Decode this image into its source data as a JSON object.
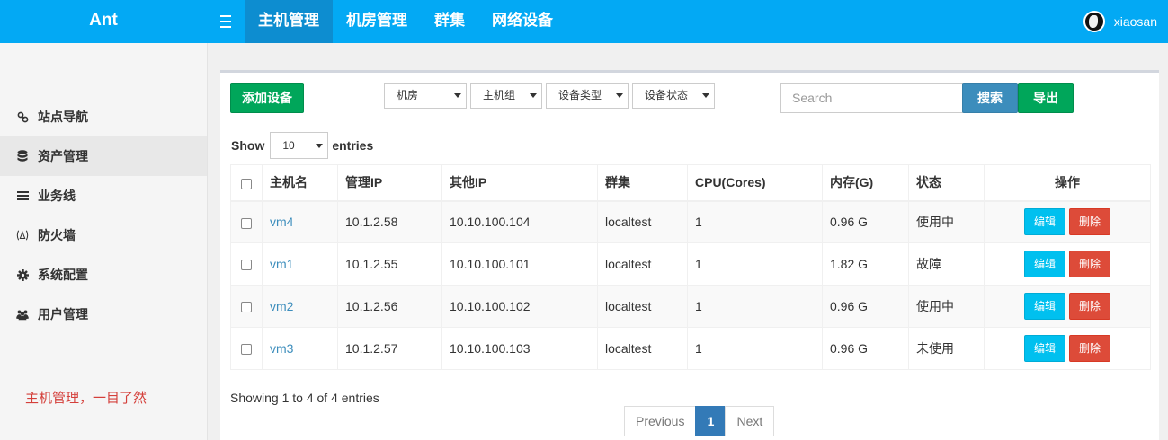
{
  "app": {
    "brand": "Ant"
  },
  "nav": {
    "items": [
      {
        "label": "主机管理",
        "active": true
      },
      {
        "label": "机房管理",
        "active": false
      },
      {
        "label": "群集",
        "active": false
      },
      {
        "label": "网络设备",
        "active": false
      }
    ],
    "username": "xiaosan"
  },
  "sidebar": {
    "items": [
      {
        "label": "站点导航",
        "icon": "link-icon"
      },
      {
        "label": "资产管理",
        "icon": "database-icon",
        "active": true
      },
      {
        "label": "业务线",
        "icon": "list-icon"
      },
      {
        "label": "防火墙",
        "icon": "fire-icon"
      },
      {
        "label": "系统配置",
        "icon": "gear-icon"
      },
      {
        "label": "用户管理",
        "icon": "users-icon"
      }
    ],
    "note": "主机管理，一目了然"
  },
  "toolbar": {
    "add_label": "添加设备",
    "filters": [
      "机房",
      "主机组",
      "设备类型",
      "设备状态"
    ],
    "search_placeholder": "Search",
    "search_label": "搜索",
    "export_label": "导出"
  },
  "length": {
    "show": "Show",
    "value": "10",
    "entries": "entries"
  },
  "table": {
    "headers": [
      "主机名",
      "管理IP",
      "其他IP",
      "群集",
      "CPU(Cores)",
      "内存(G)",
      "状态",
      "操作"
    ],
    "rows": [
      {
        "name": "vm4",
        "mgmt_ip": "10.1.2.58",
        "other_ip": "10.10.100.104",
        "cluster": "localtest",
        "cpu": "1",
        "mem": "0.96 G",
        "status": "使用中"
      },
      {
        "name": "vm1",
        "mgmt_ip": "10.1.2.55",
        "other_ip": "10.10.100.101",
        "cluster": "localtest",
        "cpu": "1",
        "mem": "1.82 G",
        "status": "故障"
      },
      {
        "name": "vm2",
        "mgmt_ip": "10.1.2.56",
        "other_ip": "10.10.100.102",
        "cluster": "localtest",
        "cpu": "1",
        "mem": "0.96 G",
        "status": "使用中"
      },
      {
        "name": "vm3",
        "mgmt_ip": "10.1.2.57",
        "other_ip": "10.10.100.103",
        "cluster": "localtest",
        "cpu": "1",
        "mem": "0.96 G",
        "status": "未使用"
      }
    ],
    "edit_label": "编辑",
    "delete_label": "删除"
  },
  "footer": {
    "info": "Showing 1 to 4 of 4 entries",
    "previous": "Previous",
    "page": "1",
    "next": "Next"
  },
  "colors": {
    "navbar": "#03a9f4",
    "success": "#00a65a",
    "primary": "#3c8dbc",
    "info": "#00c0ef",
    "danger": "#dd4b39"
  }
}
